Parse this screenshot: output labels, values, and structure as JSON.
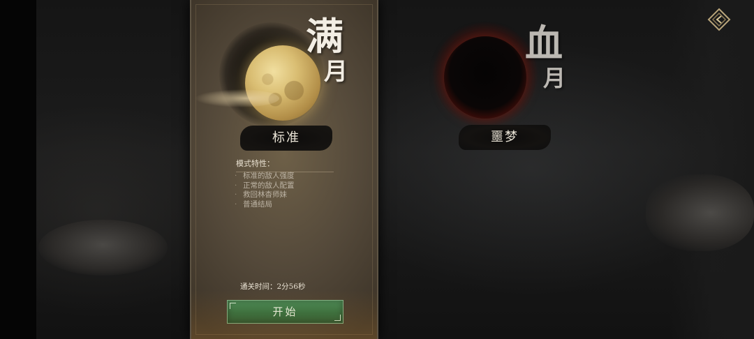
{
  "modes": {
    "standard": {
      "calligraphy_top": "满",
      "calligraphy_bottom": "月",
      "label": "标准",
      "features_title": "模式特性：",
      "features": [
        "标准的敌人强度",
        "正常的敌人配置",
        "救回林杳师妹",
        "普通结局"
      ],
      "clear_time": "通关时间：2分56秒",
      "start_label": "开始"
    },
    "nightmare": {
      "calligraphy_top": "血",
      "calligraphy_bottom": "月",
      "label": "噩梦"
    }
  },
  "bullet": "·",
  "icons": {
    "back": "diamond-back-icon"
  },
  "colors": {
    "start_button": "#2f6e40",
    "blood_moon_rim": "#c6452a",
    "full_moon": "#d9bd72"
  }
}
